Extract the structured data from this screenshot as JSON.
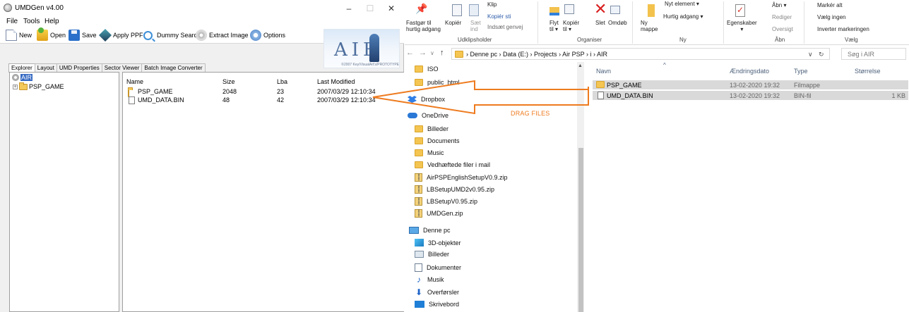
{
  "umdgen": {
    "title": "UMDGen v4.00",
    "menu": [
      "File",
      "Tools",
      "Help"
    ],
    "toolbar": {
      "new": "New",
      "open": "Open",
      "save": "Save",
      "apply_ppf": "Apply PPF",
      "dummy_search": "Dummy Search",
      "extract_image": "Extract Image",
      "options": "Options"
    },
    "logo": {
      "text": "AIR",
      "copyright": "©2007 Key/VisualArt's/PROTOTYPE"
    },
    "tabs": [
      "Explorer",
      "Layout",
      "UMD Properties",
      "Sector Viewer",
      "Batch Image Converter"
    ],
    "tree": {
      "root": "AIR",
      "child": "PSP_GAME"
    },
    "list": {
      "headers": {
        "name": "Name",
        "size": "Size",
        "lba": "Lba",
        "modified": "Last Modified"
      },
      "rows": [
        {
          "name": "PSP_GAME",
          "size": "2048",
          "lba": "23",
          "modified": "2007/03/29  12:10:34",
          "icon": "folder-icon"
        },
        {
          "name": "UMD_DATA.BIN",
          "size": "48",
          "lba": "42",
          "modified": "2007/03/29  12:10:34",
          "icon": "file-icon"
        }
      ]
    }
  },
  "explorer": {
    "ribbon": {
      "pin": "Fastgør til\nhurtig adgang",
      "copy": "Kopiér",
      "paste": "Sæt\nind",
      "cut": "Klip",
      "copy_path": "Kopiér sti",
      "paste_shortcut": "Indsæt genvej",
      "move_to": "Flyt\ntil ▾",
      "copy_to": "Kopiér\ntil ▾",
      "delete": "Slet",
      "rename": "Omdøb",
      "new_folder": "Ny\nmappe",
      "new_item": "Nyt element ▾",
      "easy_access": "Hurtig adgang ▾",
      "properties": "Egenskaber\n▾",
      "open": "Åbn ▾",
      "edit": "Rediger",
      "history": "Oversigt",
      "select_all": "Markér alt",
      "select_none": "Vælg ingen",
      "invert": "Inverter markeringen",
      "groups": {
        "clipboard": "Udklipsholder",
        "organize": "Organiser",
        "new": "Ny",
        "open": "Åbn",
        "select": "Vælg"
      }
    },
    "path": [
      "Denne pc",
      "Data (E:)",
      "Projects",
      "Air PSP",
      "i",
      "AIR"
    ],
    "search_placeholder": "Søg i AIR",
    "nav": [
      {
        "label": "ISO",
        "icon": "folder-icon"
      },
      {
        "label": "public_html",
        "icon": "folder-icon"
      },
      {
        "label": "Dropbox",
        "icon": "dropbox-icon"
      },
      {
        "label": "OneDrive",
        "icon": "onedrive-icon"
      },
      {
        "label": "Billeder",
        "icon": "folder-icon"
      },
      {
        "label": "Documents",
        "icon": "folder-icon"
      },
      {
        "label": "Music",
        "icon": "folder-icon"
      },
      {
        "label": "Vedhæftede filer i mail",
        "icon": "folder-icon"
      },
      {
        "label": "AirPSPEnglishSetupV0.9.zip",
        "icon": "zip-icon"
      },
      {
        "label": "LBSetupUMD2v0.95.zip",
        "icon": "zip-icon"
      },
      {
        "label": "LBSetupV0.95.zip",
        "icon": "zip-icon"
      },
      {
        "label": "UMDGen.zip",
        "icon": "zip-icon"
      },
      {
        "label": "Denne pc",
        "icon": "pc-icon"
      },
      {
        "label": "3D-objekter",
        "icon": "3d-objects-icon"
      },
      {
        "label": "Billeder",
        "icon": "pictures-icon"
      },
      {
        "label": "Dokumenter",
        "icon": "documents-icon"
      },
      {
        "label": "Musik",
        "icon": "music-icon"
      },
      {
        "label": "Overførsler",
        "icon": "downloads-icon"
      },
      {
        "label": "Skrivebord",
        "icon": "desktop-icon"
      }
    ],
    "columns": {
      "name": "Navn",
      "date": "Ændringsdato",
      "type": "Type",
      "size": "Størrelse"
    },
    "files": [
      {
        "name": "PSP_GAME",
        "date": "13-02-2020 19:32",
        "type": "Filmappe",
        "size": "",
        "icon": "folder-icon"
      },
      {
        "name": "UMD_DATA.BIN",
        "date": "13-02-2020 19:32",
        "type": "BIN-fil",
        "size": "1 KB",
        "icon": "file-icon"
      }
    ]
  },
  "annotation": {
    "text": "DRAG FILES",
    "color": "#ee7b1f"
  }
}
